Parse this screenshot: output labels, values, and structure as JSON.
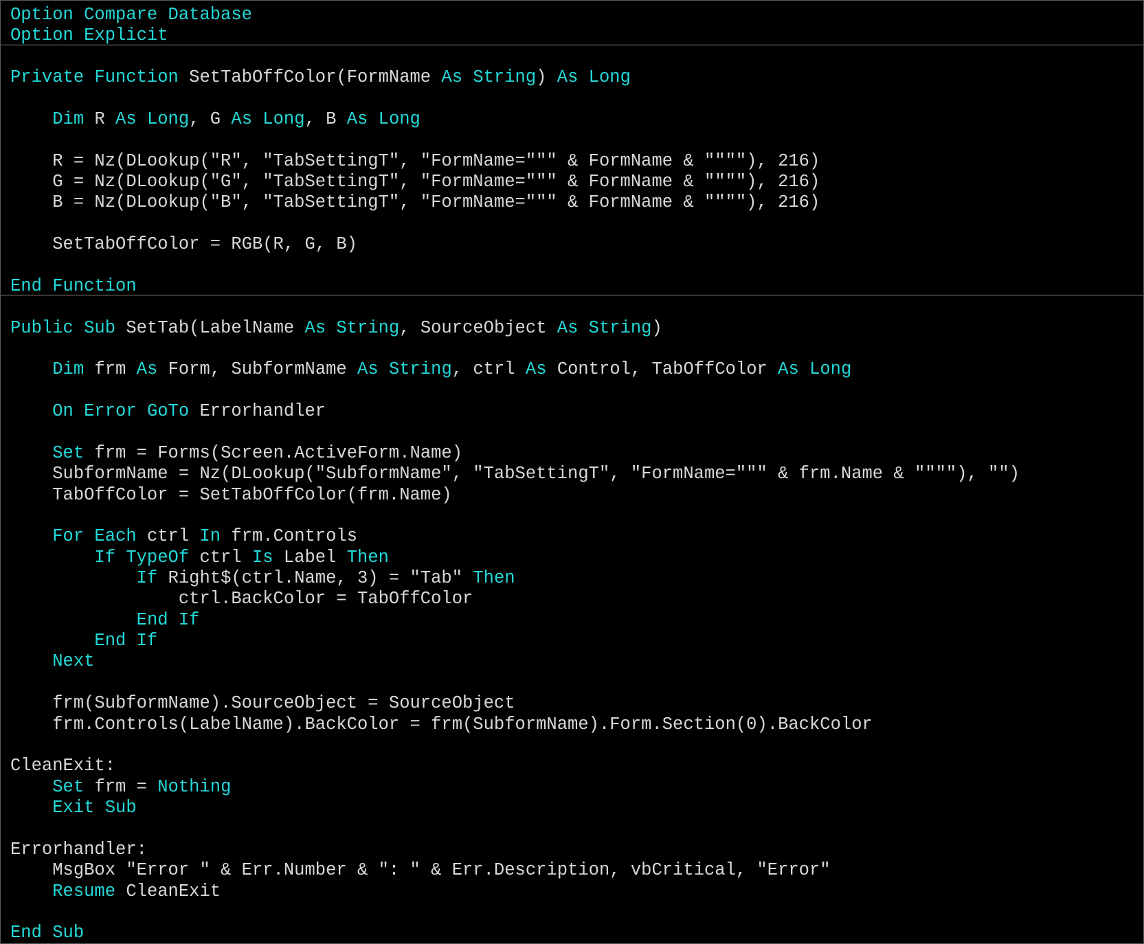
{
  "colors": {
    "background": "#000000",
    "keyword": "#24d8d8",
    "text": "#d8d8d8",
    "separator": "#8a8a8a"
  },
  "code": {
    "lines": [
      [
        [
          "k",
          "Option Compare Database"
        ]
      ],
      [
        [
          "k",
          "Option Explicit"
        ]
      ],
      [],
      [
        [
          "k",
          "Private Function "
        ],
        [
          "t",
          "SetTabOffColor(FormName "
        ],
        [
          "k",
          "As String"
        ],
        [
          "t",
          ") "
        ],
        [
          "k",
          "As Long"
        ]
      ],
      [],
      [
        [
          "t",
          "    "
        ],
        [
          "k",
          "Dim "
        ],
        [
          "t",
          "R "
        ],
        [
          "k",
          "As Long"
        ],
        [
          "t",
          ", G "
        ],
        [
          "k",
          "As Long"
        ],
        [
          "t",
          ", B "
        ],
        [
          "k",
          "As Long"
        ]
      ],
      [],
      [
        [
          "t",
          "    R = Nz(DLookup(\"R\", \"TabSettingT\", \"FormName=\"\"\" & FormName & \"\"\"\"), 216)"
        ]
      ],
      [
        [
          "t",
          "    G = Nz(DLookup(\"G\", \"TabSettingT\", \"FormName=\"\"\" & FormName & \"\"\"\"), 216)"
        ]
      ],
      [
        [
          "t",
          "    B = Nz(DLookup(\"B\", \"TabSettingT\", \"FormName=\"\"\" & FormName & \"\"\"\"), 216)"
        ]
      ],
      [],
      [
        [
          "t",
          "    SetTabOffColor = RGB(R, G, B)"
        ]
      ],
      [],
      [
        [
          "k",
          "End Function"
        ]
      ],
      [],
      [
        [
          "k",
          "Public Sub "
        ],
        [
          "t",
          "SetTab(LabelName "
        ],
        [
          "k",
          "As String"
        ],
        [
          "t",
          ", SourceObject "
        ],
        [
          "k",
          "As String"
        ],
        [
          "t",
          ")"
        ]
      ],
      [],
      [
        [
          "t",
          "    "
        ],
        [
          "k",
          "Dim "
        ],
        [
          "t",
          "frm "
        ],
        [
          "k",
          "As "
        ],
        [
          "t",
          "Form, SubformName "
        ],
        [
          "k",
          "As String"
        ],
        [
          "t",
          ", ctrl "
        ],
        [
          "k",
          "As "
        ],
        [
          "t",
          "Control, TabOffColor "
        ],
        [
          "k",
          "As Long"
        ]
      ],
      [],
      [
        [
          "t",
          "    "
        ],
        [
          "k",
          "On Error GoTo "
        ],
        [
          "t",
          "Errorhandler"
        ]
      ],
      [],
      [
        [
          "t",
          "    "
        ],
        [
          "k",
          "Set "
        ],
        [
          "t",
          "frm = Forms(Screen.ActiveForm.Name)"
        ]
      ],
      [
        [
          "t",
          "    SubformName = Nz(DLookup(\"SubformName\", \"TabSettingT\", \"FormName=\"\"\" & frm.Name & \"\"\"\"), \"\")"
        ]
      ],
      [
        [
          "t",
          "    TabOffColor = SetTabOffColor(frm.Name)"
        ]
      ],
      [],
      [
        [
          "t",
          "    "
        ],
        [
          "k",
          "For Each "
        ],
        [
          "t",
          "ctrl "
        ],
        [
          "k",
          "In "
        ],
        [
          "t",
          "frm.Controls"
        ]
      ],
      [
        [
          "t",
          "        "
        ],
        [
          "k",
          "If TypeOf "
        ],
        [
          "t",
          "ctrl "
        ],
        [
          "k",
          "Is "
        ],
        [
          "t",
          "Label "
        ],
        [
          "k",
          "Then"
        ]
      ],
      [
        [
          "t",
          "            "
        ],
        [
          "k",
          "If "
        ],
        [
          "t",
          "Right$(ctrl.Name, 3) = \"Tab\" "
        ],
        [
          "k",
          "Then"
        ]
      ],
      [
        [
          "t",
          "                ctrl.BackColor = TabOffColor"
        ]
      ],
      [
        [
          "t",
          "            "
        ],
        [
          "k",
          "End If"
        ]
      ],
      [
        [
          "t",
          "        "
        ],
        [
          "k",
          "End If"
        ]
      ],
      [
        [
          "t",
          "    "
        ],
        [
          "k",
          "Next"
        ]
      ],
      [],
      [
        [
          "t",
          "    frm(SubformName).SourceObject = SourceObject"
        ]
      ],
      [
        [
          "t",
          "    frm.Controls(LabelName).BackColor = frm(SubformName).Form.Section(0).BackColor"
        ]
      ],
      [],
      [
        [
          "t",
          "CleanExit:"
        ]
      ],
      [
        [
          "t",
          "    "
        ],
        [
          "k",
          "Set "
        ],
        [
          "t",
          "frm = "
        ],
        [
          "k",
          "Nothing"
        ]
      ],
      [
        [
          "t",
          "    "
        ],
        [
          "k",
          "Exit Sub"
        ]
      ],
      [],
      [
        [
          "t",
          "Errorhandler:"
        ]
      ],
      [
        [
          "t",
          "    MsgBox \"Error \" & Err.Number & \": \" & Err.Description, vbCritical, \"Error\""
        ]
      ],
      [
        [
          "t",
          "    "
        ],
        [
          "k",
          "Resume "
        ],
        [
          "t",
          "CleanExit"
        ]
      ],
      [],
      [
        [
          "k",
          "End Sub"
        ]
      ]
    ]
  }
}
